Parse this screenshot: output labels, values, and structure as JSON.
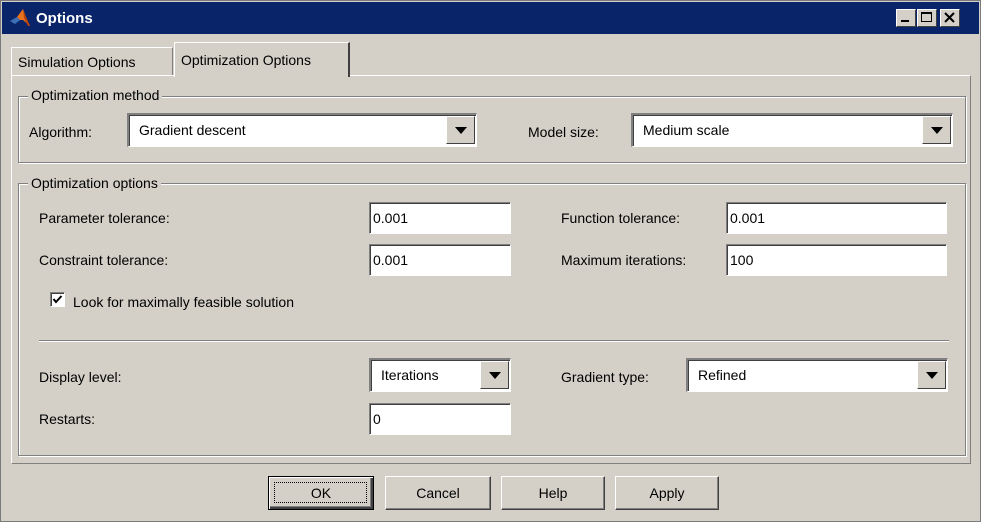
{
  "window": {
    "title": "Options",
    "controls": [
      "minimize-icon",
      "maximize-icon",
      "close-icon"
    ]
  },
  "tabs": [
    {
      "label": "Simulation Options",
      "active": false
    },
    {
      "label": "Optimization Options",
      "active": true
    }
  ],
  "optimization_method": {
    "legend": "Optimization method",
    "algorithm_label": "Algorithm:",
    "algorithm_value": "Gradient descent",
    "model_size_label": "Model size:",
    "model_size_value": "Medium scale"
  },
  "optimization_options": {
    "legend": "Optimization options",
    "parameter_tolerance_label": "Parameter tolerance:",
    "parameter_tolerance_value": "0.001",
    "function_tolerance_label": "Function tolerance:",
    "function_tolerance_value": "0.001",
    "constraint_tolerance_label": "Constraint tolerance:",
    "constraint_tolerance_value": "0.001",
    "maximum_iterations_label": "Maximum iterations:",
    "maximum_iterations_value": "100",
    "feasible_checkbox_label": "Look for maximally feasible solution",
    "feasible_checked": true,
    "display_level_label": "Display level:",
    "display_level_value": "Iterations",
    "gradient_type_label": "Gradient type:",
    "gradient_type_value": "Refined",
    "restarts_label": "Restarts:",
    "restarts_value": "0"
  },
  "buttons": {
    "ok": "OK",
    "cancel": "Cancel",
    "help": "Help",
    "apply": "Apply"
  },
  "colors": {
    "titlebar": "#0a246a",
    "face": "#d4d0c8"
  }
}
